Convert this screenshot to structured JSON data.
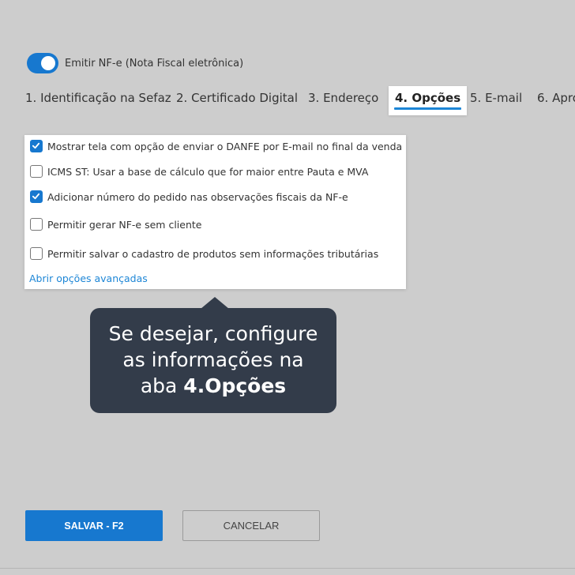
{
  "nfe_toggle": {
    "label": "Emitir NF-e (Nota Fiscal eletrônica)",
    "on": true
  },
  "tabs": [
    {
      "label": "1. Identificação na Sefaz",
      "active": false
    },
    {
      "label": "2. Certificado Digital",
      "active": false
    },
    {
      "label": "3. Endereço",
      "active": false
    },
    {
      "label": "4. Opções",
      "active": true
    },
    {
      "label": "5. E-mail",
      "active": false
    },
    {
      "label": "6. Apro",
      "active": false
    }
  ],
  "options": [
    {
      "label": "Mostrar tela com opção de enviar o DANFE por E-mail no final da venda",
      "checked": true
    },
    {
      "label": "ICMS ST: Usar a base de cálculo que for maior entre Pauta e MVA",
      "checked": false
    },
    {
      "label": "Adicionar número do pedido nas observações fiscais da NF-e",
      "checked": true
    },
    {
      "label": "Permitir gerar NF-e sem cliente",
      "checked": false
    },
    {
      "label": "Permitir salvar o cadastro de produtos sem informações tributárias",
      "checked": false
    }
  ],
  "advanced_link": "Abrir opções avançadas",
  "tooltip": {
    "line1": "Se desejar, configure",
    "line2": "as informações na",
    "line3_prefix": "aba ",
    "line3_bold": "4.Opções"
  },
  "buttons": {
    "save": "SALVAR - F2",
    "cancel": "CANCELAR"
  },
  "colors": {
    "accent": "#1778cf",
    "tooltip_bg": "#333c4a",
    "background": "#cdcdcd"
  }
}
